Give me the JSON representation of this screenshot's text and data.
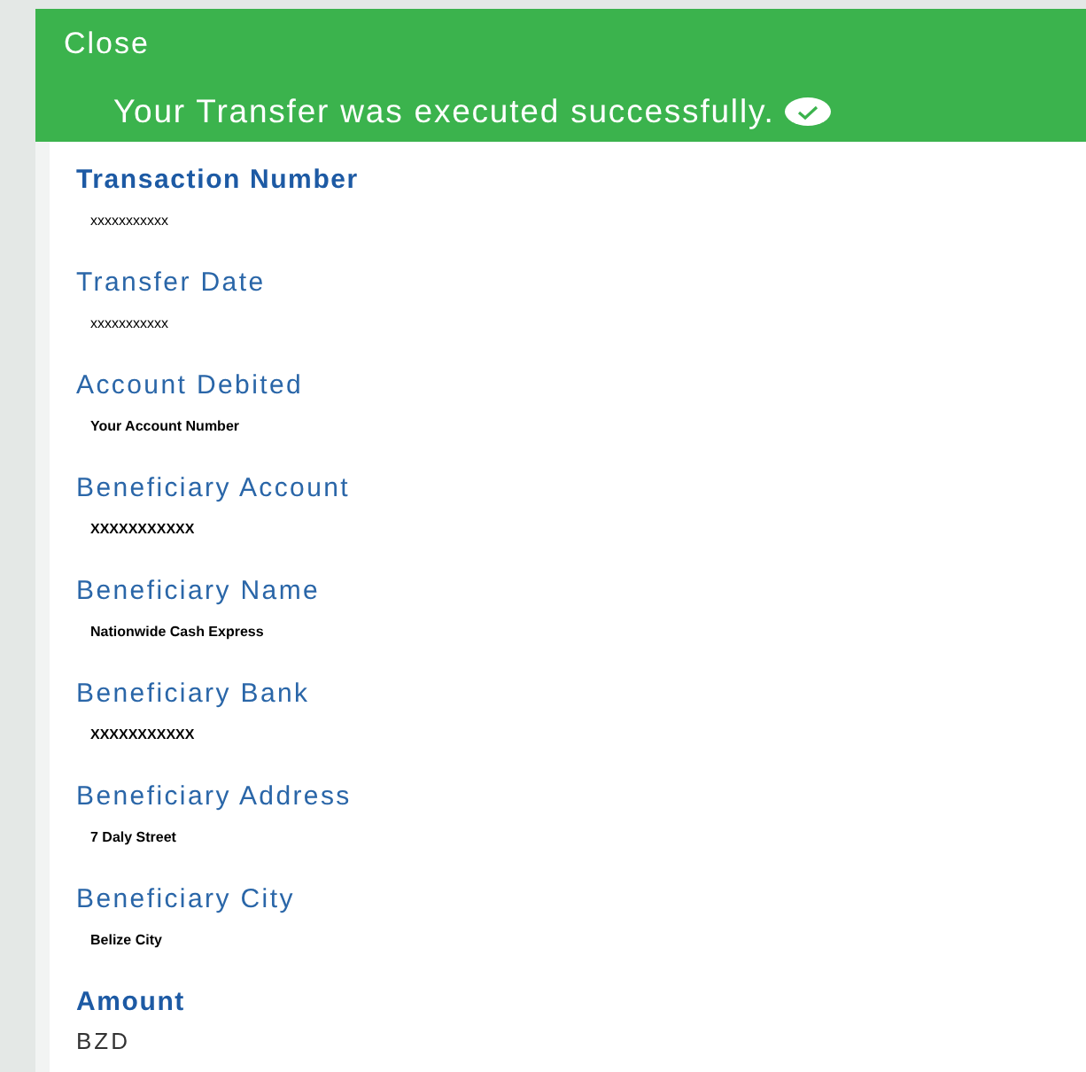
{
  "header": {
    "close_label": "Close",
    "message": "Your Transfer was executed successfully."
  },
  "fields": [
    {
      "label": "Transaction Number",
      "value": "xxxxxxxxxxx",
      "kind": "heading"
    },
    {
      "label": "Transfer Date",
      "value": "xxxxxxxxxxx",
      "kind": "code"
    },
    {
      "label": "Account Debited",
      "value": "Your Account Number",
      "kind": "text"
    },
    {
      "label": "Beneficiary Account",
      "value": "XXXXXXXXXXX",
      "kind": "text"
    },
    {
      "label": "Beneficiary Name",
      "value": "Nationwide Cash Express",
      "kind": "text"
    },
    {
      "label": "Beneficiary Bank",
      "value": "XXXXXXXXXXX",
      "kind": "text"
    },
    {
      "label": "Beneficiary Address",
      "value": "7 Daly Street",
      "kind": "text"
    },
    {
      "label": "Beneficiary City",
      "value": "Belize City",
      "kind": "text"
    },
    {
      "label": "Amount",
      "value": "BZD",
      "kind": "total"
    }
  ]
}
